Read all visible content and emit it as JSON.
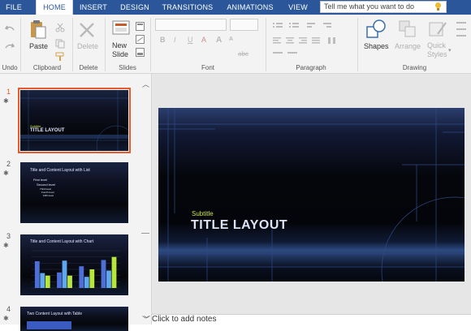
{
  "tabs": [
    {
      "label": "FILE",
      "active": false
    },
    {
      "label": "HOME",
      "active": true
    },
    {
      "label": "INSERT",
      "active": false
    },
    {
      "label": "DESIGN",
      "active": false
    },
    {
      "label": "TRANSITIONS",
      "active": false
    },
    {
      "label": "ANIMATIONS",
      "active": false
    },
    {
      "label": "VIEW",
      "active": false
    }
  ],
  "tell_me": {
    "placeholder": "Tell me what you want to do",
    "icon": "lightbulb-icon"
  },
  "ribbon": {
    "undo": {
      "label": "Undo"
    },
    "clipboard": {
      "label": "Clipboard",
      "paste": "Paste"
    },
    "delete": {
      "label": "Delete",
      "button": "Delete"
    },
    "slides": {
      "label": "Slides",
      "new_slide_line1": "New",
      "new_slide_line2": "Slide"
    },
    "font": {
      "label": "Font",
      "bold": "B",
      "italic": "I",
      "underline": "U",
      "strike": "abc",
      "grow": "A",
      "shrink": "A",
      "color": "A"
    },
    "paragraph": {
      "label": "Paragraph"
    },
    "drawing": {
      "label": "Drawing",
      "shapes": "Shapes",
      "arrange": "Arrange",
      "quick_styles_line1": "Quick",
      "quick_styles_line2": "Styles"
    }
  },
  "slides": [
    {
      "number": "1",
      "selected": true,
      "subtitle": "Subtitle",
      "title": "TITLE LAYOUT"
    },
    {
      "number": "2",
      "selected": false,
      "title": "Title and Content Layout with List",
      "bullets": [
        "First level",
        "Second level",
        "Third level",
        "Fourth level",
        "Fifth level"
      ]
    },
    {
      "number": "3",
      "selected": false,
      "title": "Title and Content Layout with Chart"
    },
    {
      "number": "4",
      "selected": false,
      "title": "Two Content Layout with Table"
    }
  ],
  "chart_data": {
    "type": "bar",
    "categories": [
      "1",
      "2",
      "3",
      "4"
    ],
    "series": [
      {
        "values": [
          4.3,
          2.5,
          3.5,
          4.5
        ]
      },
      {
        "values": [
          2.4,
          4.4,
          1.8,
          2.8
        ]
      },
      {
        "values": [
          2.0,
          2.0,
          3.0,
          5.0
        ]
      }
    ],
    "ylim": [
      0,
      6
    ],
    "colors": [
      "#4f6fd8",
      "#5fa8f0",
      "#b7e63a"
    ]
  },
  "main_slide": {
    "subtitle": "Subtitle",
    "title": "TITLE LAYOUT"
  },
  "notes": {
    "placeholder": "Click to add notes"
  },
  "colors": {
    "accent": "#2b579a",
    "selection": "#e55b2b",
    "subtitle": "#c9e23a"
  }
}
